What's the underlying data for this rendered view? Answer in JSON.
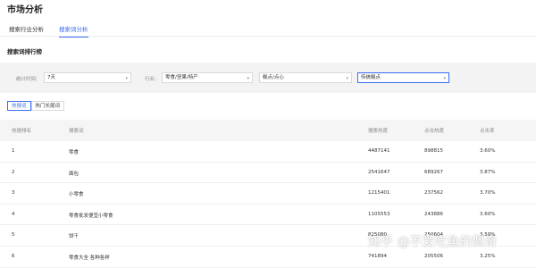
{
  "page": {
    "title": "市场分析"
  },
  "tabs": [
    {
      "label": "搜索行业分析",
      "active": false
    },
    {
      "label": "搜索词分析",
      "active": true
    }
  ],
  "section": {
    "title": "搜索词排行榜"
  },
  "filters": {
    "period_label": "统计时间:",
    "period_value": "7天",
    "industry_label": "行业:",
    "industry_value": "零食/坚果/特产",
    "category_value": "糕点/点心",
    "subcategory_value": "传统糕点"
  },
  "sub_tabs": [
    {
      "label": "热搜词",
      "active": true
    },
    {
      "label": "热门长尾词",
      "active": false
    }
  ],
  "table": {
    "headers": {
      "rank": "热搜排名",
      "word": "搜索词",
      "heat": "搜索热度",
      "click_heat": "点击热度",
      "ctr": "点击率"
    },
    "rows": [
      {
        "rank": "1",
        "word": "零食",
        "heat": "4487141",
        "click_heat": "898815",
        "ctr": "3.60%"
      },
      {
        "rank": "2",
        "word": "面包",
        "heat": "2541647",
        "click_heat": "689267",
        "ctr": "3.87%"
      },
      {
        "rank": "3",
        "word": "小零食",
        "heat": "1215401",
        "click_heat": "237562",
        "ctr": "3.70%"
      },
      {
        "rank": "4",
        "word": "零食批发便宜小零食",
        "heat": "1105553",
        "click_heat": "243886",
        "ctr": "3.60%"
      },
      {
        "rank": "5",
        "word": "饼干",
        "heat": "825080",
        "click_heat": "250604",
        "ctr": "3.59%"
      },
      {
        "rank": "6",
        "word": "零食大全 各种各样",
        "heat": "741894",
        "click_heat": "205506",
        "ctr": "3.25%"
      }
    ]
  },
  "watermark": {
    "text": "知乎 @不爱吃鱼的佩奇"
  },
  "colors": {
    "accent": "#3a6df0",
    "filter_bg": "#f3f3f3",
    "header_bg": "#f5f5f5"
  }
}
